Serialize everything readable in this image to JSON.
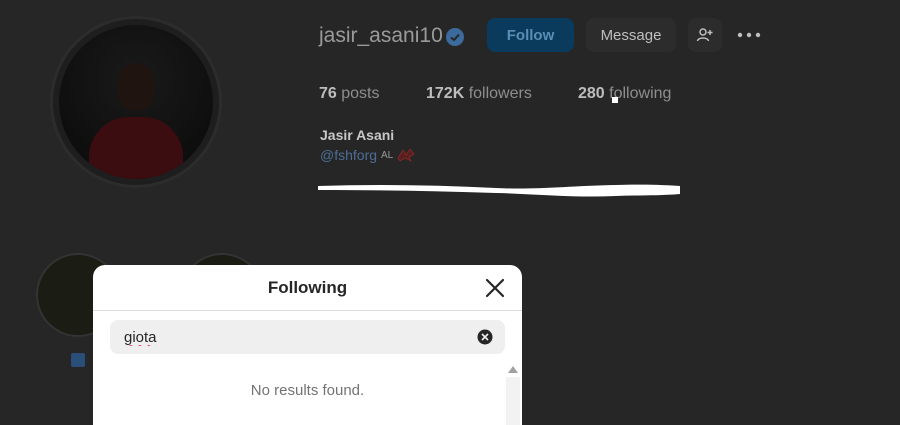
{
  "profile": {
    "username": "jasir_asani10",
    "follow_label": "Follow",
    "message_label": "Message",
    "stats": [
      {
        "value": "76",
        "label": "posts"
      },
      {
        "value": "172K",
        "label": "followers"
      },
      {
        "value": "280",
        "label": "following"
      }
    ],
    "full_name": "Jasir Asani",
    "linked_handle": "@fshforg",
    "country_tag": "AL"
  },
  "modal": {
    "title": "Following",
    "search_value": "giota",
    "empty_message": "No results found."
  },
  "icons": {
    "verified": "verified-badge-icon",
    "add_user": "add-user-icon",
    "more": "more-options-icon",
    "close": "close-icon",
    "clear": "clear-search-icon"
  },
  "colors": {
    "accent": "#0095f6",
    "background": "#262626",
    "modal": "#ffffff"
  }
}
